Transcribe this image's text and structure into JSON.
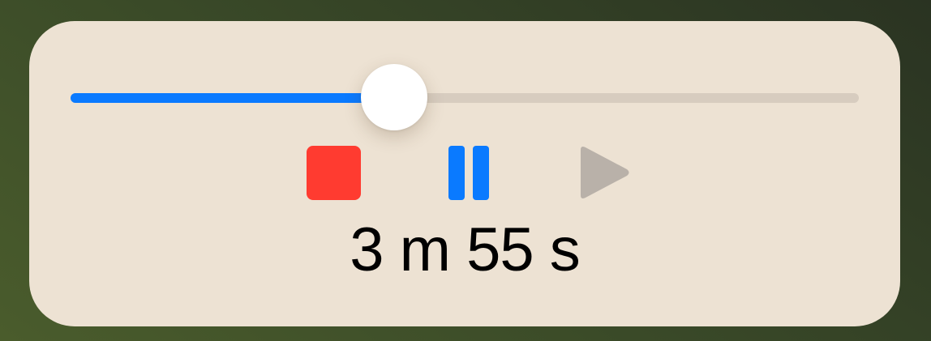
{
  "player": {
    "progress_fraction": 0.41,
    "colors": {
      "panel_background": "#ede2d3",
      "progress_fill": "#0a7aff",
      "track": "#d7ccbf",
      "stop": "#ff3b30",
      "pause": "#0a7aff",
      "play_disabled": "#b9b1a9",
      "text": "#000000"
    },
    "controls": [
      {
        "name": "stop",
        "icon": "stop-icon",
        "enabled": true
      },
      {
        "name": "pause",
        "icon": "pause-icon",
        "enabled": true
      },
      {
        "name": "play",
        "icon": "play-icon",
        "enabled": false
      }
    ],
    "elapsed_time": "3 m 55 s"
  }
}
